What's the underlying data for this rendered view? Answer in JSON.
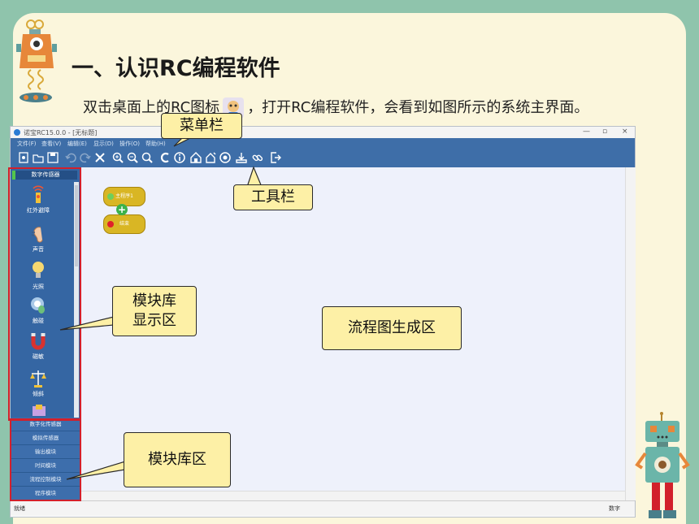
{
  "slide": {
    "title": "一、认识RC编程软件",
    "desc_before": "双击桌面上的",
    "desc_link": "RC图标",
    "desc_after": "，打开RC编程软件，会看到如图所示的系统主界面。"
  },
  "app": {
    "window_title": "诺宝RC15.0.0 - [无标题]",
    "window_controls": [
      "—",
      "▫",
      "×"
    ],
    "menu": [
      "文件(F)",
      "查看(V)",
      "编辑(E)",
      "显示(D)",
      "操作(O)",
      "帮助(H)"
    ],
    "toolbar_icons": [
      "new-icon",
      "open-icon",
      "save-icon",
      "undo-icon",
      "redo-icon",
      "delete-icon",
      "zoom-in-icon",
      "zoom-out-icon",
      "zoom-fit-icon",
      "compile-icon",
      "info-icon",
      "home-icon",
      "download-icon",
      "run-icon",
      "upload-icon",
      "link-icon",
      "exit-icon"
    ],
    "sensor_category": "数字传感器",
    "modules": [
      {
        "label": "红外避障",
        "icon": "infrared-sensor-icon"
      },
      {
        "label": "声音",
        "icon": "sound-sensor-icon"
      },
      {
        "label": "光照",
        "icon": "light-sensor-icon"
      },
      {
        "label": "触碰",
        "icon": "touch-sensor-icon"
      },
      {
        "label": "磁敏",
        "icon": "magnetic-sensor-icon"
      },
      {
        "label": "倾斜",
        "icon": "tilt-sensor-icon"
      }
    ],
    "categories": [
      "数字化传感器",
      "模拟传感器",
      "输出模块",
      "时间模块",
      "流程控制模块",
      "程序模块"
    ],
    "flow_start": "主程序1",
    "flow_end": "结束",
    "status_left": "就绪",
    "status_right": "数字"
  },
  "callouts": {
    "menubar": "菜单栏",
    "toolbar": "工具栏",
    "module_display_line1": "模块库",
    "module_display_line2": "显示区",
    "flowchart": "流程图生成区",
    "module_library": "模块库区"
  },
  "colors": {
    "frame_bg": "#8fc4ac",
    "slide_bg": "#fbf6dc",
    "app_blue": "#3e6ea8",
    "callout_fill": "#fdf0a6",
    "highlight_red": "#d2202b"
  }
}
